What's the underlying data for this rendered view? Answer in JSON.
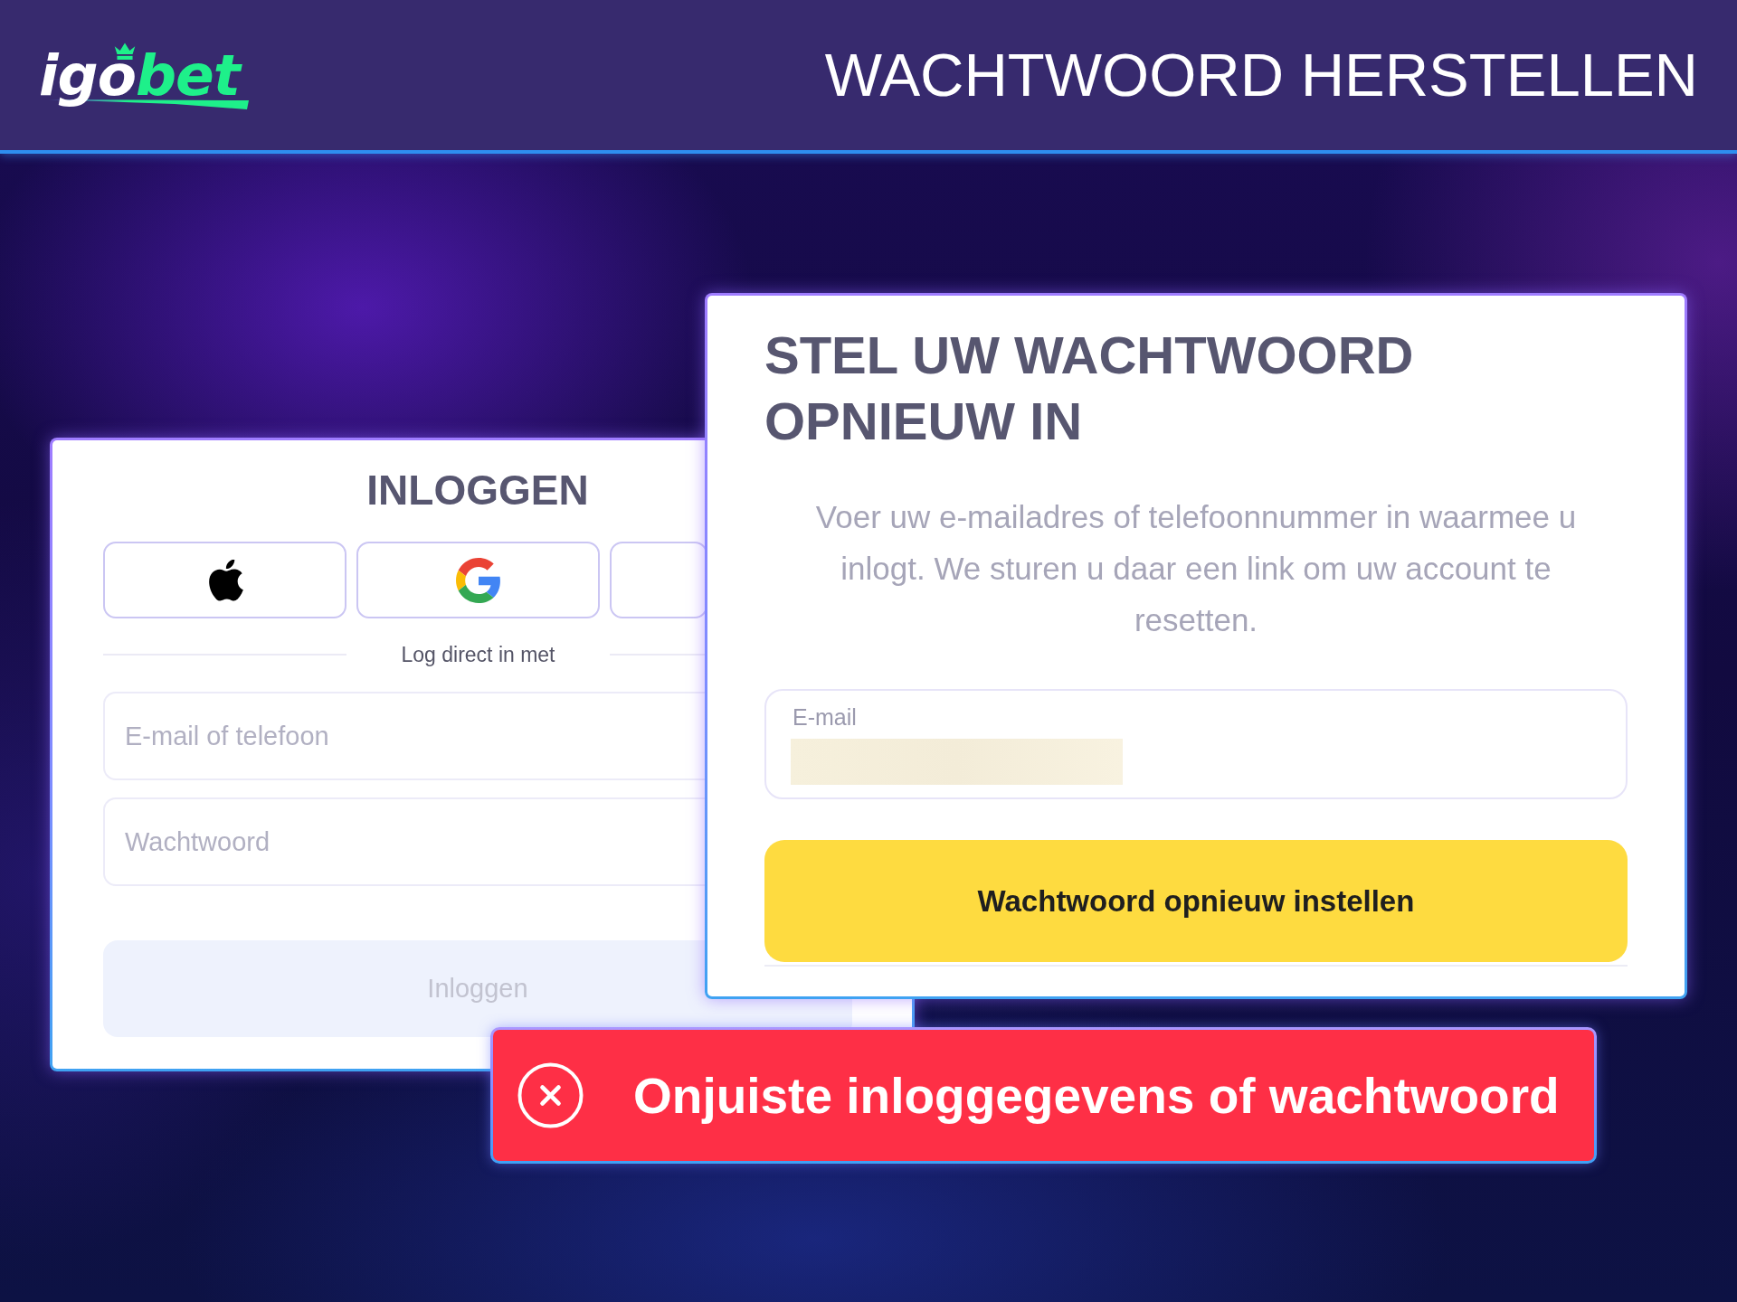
{
  "header": {
    "logo": {
      "text": "igo",
      "accent": "bet"
    },
    "title": "WACHTWOORD HERSTELLEN"
  },
  "login_panel": {
    "title": "INLOGGEN",
    "social_buttons": [
      {
        "kind": "apple"
      },
      {
        "kind": "letter-g"
      },
      {
        "kind": "covered"
      }
    ],
    "divider_text": "Log direct in met",
    "fields": [
      {
        "placeholder": "E-mail of telefoon"
      },
      {
        "placeholder": "Wachtwoord"
      }
    ],
    "submit": {
      "label": "Inloggen",
      "disabled": true
    }
  },
  "reset_panel": {
    "title": "STEL UW WACHTWOORD OPNIEUW IN",
    "description": "Voer uw e-mailadres of telefoonnummer in waarmee u inlogt. We sturen u daar een link om uw account te resetten.",
    "email_field": {
      "label": "E-mail",
      "redacted": true
    },
    "submit": {
      "label": "Wachtwoord opnieuw instellen"
    }
  },
  "error_toast": {
    "message": "Onjuiste inloggegevens of wachtwoord"
  }
}
